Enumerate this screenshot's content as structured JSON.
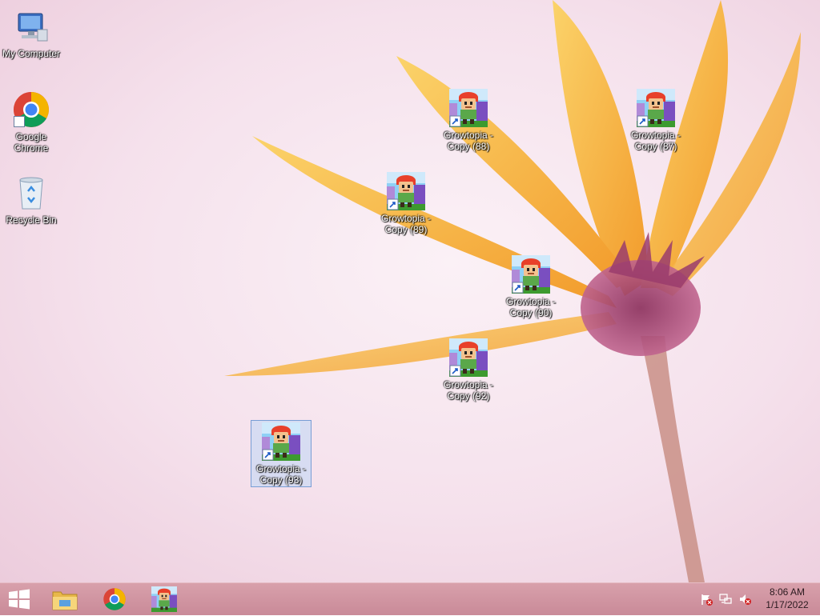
{
  "desktop": {
    "icons": [
      {
        "label": "My Computer"
      },
      {
        "label": "Google Chrome"
      },
      {
        "label": "Recycle Bin"
      },
      {
        "label": "Growtopia - Copy (88)"
      },
      {
        "label": "Growtopia - Copy (87)"
      },
      {
        "label": "Growtopia - Copy (89)"
      },
      {
        "label": "Growtopia - Copy (90)"
      },
      {
        "label": "Growtopia - Copy (92)"
      },
      {
        "label": "Growtopia - Copy (93)"
      }
    ]
  },
  "taskbar": {
    "time": "8:06 AM",
    "date": "1/17/2022",
    "items": [
      "start-button",
      "file-explorer",
      "google-chrome",
      "growtopia"
    ],
    "tray": [
      "action-center-flag-icon",
      "network-icon",
      "volume-muted-icon"
    ],
    "colors": {
      "bar": "#c98a98",
      "accent_flower": "#f5a623"
    }
  }
}
